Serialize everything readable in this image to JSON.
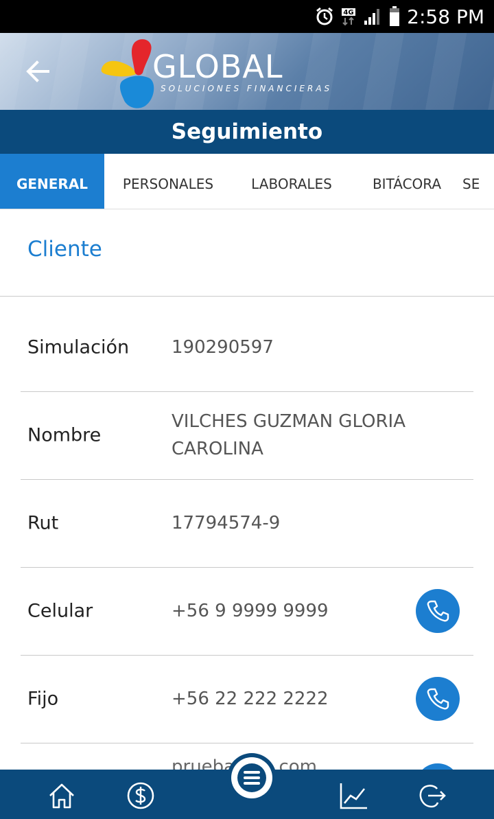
{
  "status_bar": {
    "time": "2:58 PM",
    "network": "4G",
    "icons": [
      "alarm-icon",
      "network-4g-icon",
      "signal-icon",
      "battery-icon"
    ]
  },
  "header": {
    "back_icon": "arrow-left-icon",
    "logo_text": "GLOBAL",
    "logo_subtext": "SOLUCIONES FINANCIERAS"
  },
  "title": "Seguimiento",
  "tabs": [
    {
      "label": "GENERAL",
      "active": true
    },
    {
      "label": "PERSONALES",
      "active": false
    },
    {
      "label": "LABORALES",
      "active": false
    },
    {
      "label": "BITÁCORA",
      "active": false
    },
    {
      "label": "SE",
      "active": false
    }
  ],
  "section": {
    "title": "Cliente"
  },
  "fields": [
    {
      "label": "Simulación",
      "value": "190290597"
    },
    {
      "label": "Nombre",
      "value": "VILCHES GUZMAN GLORIA CAROLINA"
    },
    {
      "label": "Rut",
      "value": "17794574-9"
    },
    {
      "label": "Celular",
      "value": "+56 9 9999 9999",
      "action_icon": "phone-icon"
    },
    {
      "label": "Fijo",
      "value": "+56 22 222 2222",
      "action_icon": "phone-icon"
    }
  ],
  "partial_value": "pruebas@...com",
  "bottom_nav": [
    "home-icon",
    "dollar-icon",
    "menu-icon",
    "chart-icon",
    "logout-icon"
  ],
  "colors": {
    "primary_dark": "#0b4a7c",
    "primary_blue": "#1c7ed0",
    "logo_red": "#e4262b",
    "logo_yellow": "#f6c510",
    "logo_blue": "#1a8ad8"
  }
}
